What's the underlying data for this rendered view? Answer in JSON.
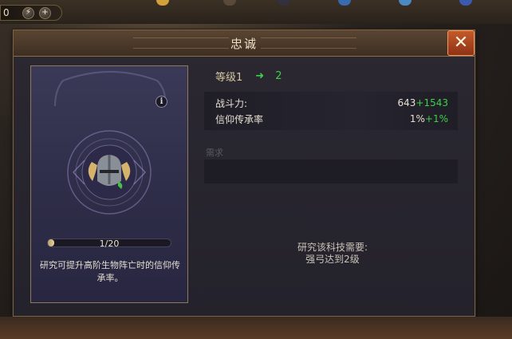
{
  "hud": {
    "counter": "0",
    "lightning_label": "⚡",
    "plus_label": "+"
  },
  "dialog": {
    "title": "忠诚",
    "close_label": "✕"
  },
  "card": {
    "info_label": "i",
    "progress": {
      "text": "1/20",
      "current": 1,
      "max": 20
    },
    "description": "研究可提升高阶生物阵亡时的信仰传承率。"
  },
  "level": {
    "current_label": "等级1",
    "arrow": "➜",
    "next": "2"
  },
  "stats": [
    {
      "label": "战斗力:",
      "value": "643",
      "bonus": "+1543"
    },
    {
      "label": "信仰传承率",
      "value": "1%",
      "bonus": "+1%"
    }
  ],
  "requirement": {
    "title": "需求",
    "text_line1": "研究该科技需要:",
    "text_line2": "强弓达到2级"
  },
  "colors": {
    "bonus_green": "#3fd04a",
    "close_orange": "#c45a2a",
    "gold_border": "#8e7a5a"
  }
}
